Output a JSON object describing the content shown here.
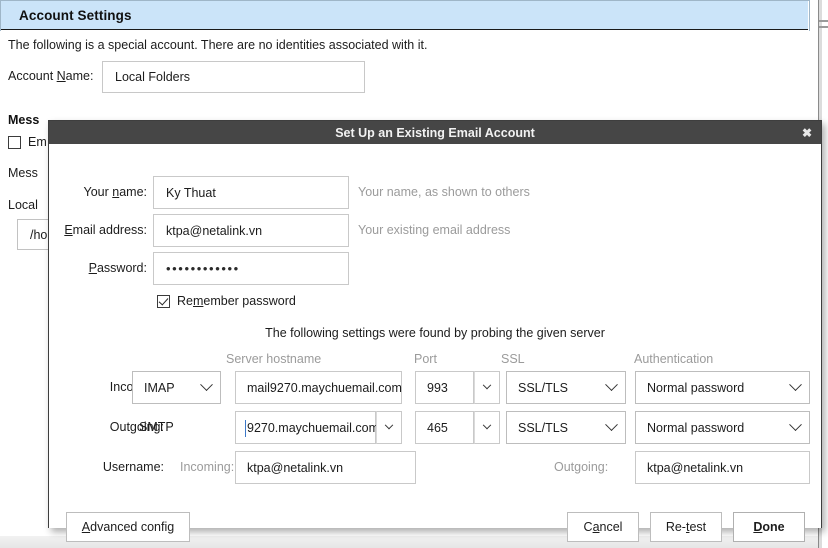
{
  "background": {
    "header_title": "Account Settings",
    "description": "The following is a special account. There are no identities associated with it.",
    "account_name_label": "Account Name:",
    "account_name_value": "Local Folders",
    "message_store_heading": "Mess",
    "empty_trash_label": "Em",
    "message_line_label": "Mess",
    "local_directory_label": "Local",
    "local_directory_value": "/ho"
  },
  "dialog": {
    "title": "Set Up an Existing Email Account",
    "close_label": "✖",
    "fields": {
      "your_name_label": "Your name:",
      "your_name_value": "Ky Thuat",
      "your_name_hint": "Your name, as shown to others",
      "email_label": "Email address:",
      "email_value": "ktpa@netalink.vn",
      "email_hint": "Your existing email address",
      "password_label": "Password:",
      "password_value": "••••••••••••",
      "remember_password_label": "Remember password",
      "remember_password_checked": true
    },
    "probe_message": "The following settings were found by probing the given server",
    "columns": {
      "hostname": "Server hostname",
      "port": "Port",
      "ssl": "SSL",
      "auth": "Authentication"
    },
    "incoming": {
      "label": "Incoming:",
      "protocol": "IMAP",
      "hostname": "mail9270.maychuemail.com",
      "port": "993",
      "ssl": "SSL/TLS",
      "auth": "Normal password"
    },
    "outgoing": {
      "label": "Outgoing:",
      "protocol": "SMTP",
      "hostname": "9270.maychuemail.com",
      "port": "465",
      "ssl": "SSL/TLS",
      "auth": "Normal password"
    },
    "username": {
      "label": "Username:",
      "incoming_label": "Incoming:",
      "incoming_value": "ktpa@netalink.vn",
      "outgoing_label": "Outgoing:",
      "outgoing_value": "ktpa@netalink.vn"
    },
    "buttons": {
      "advanced": "Advanced config",
      "cancel": "Cancel",
      "retest": "Re-test",
      "done": "Done"
    }
  }
}
